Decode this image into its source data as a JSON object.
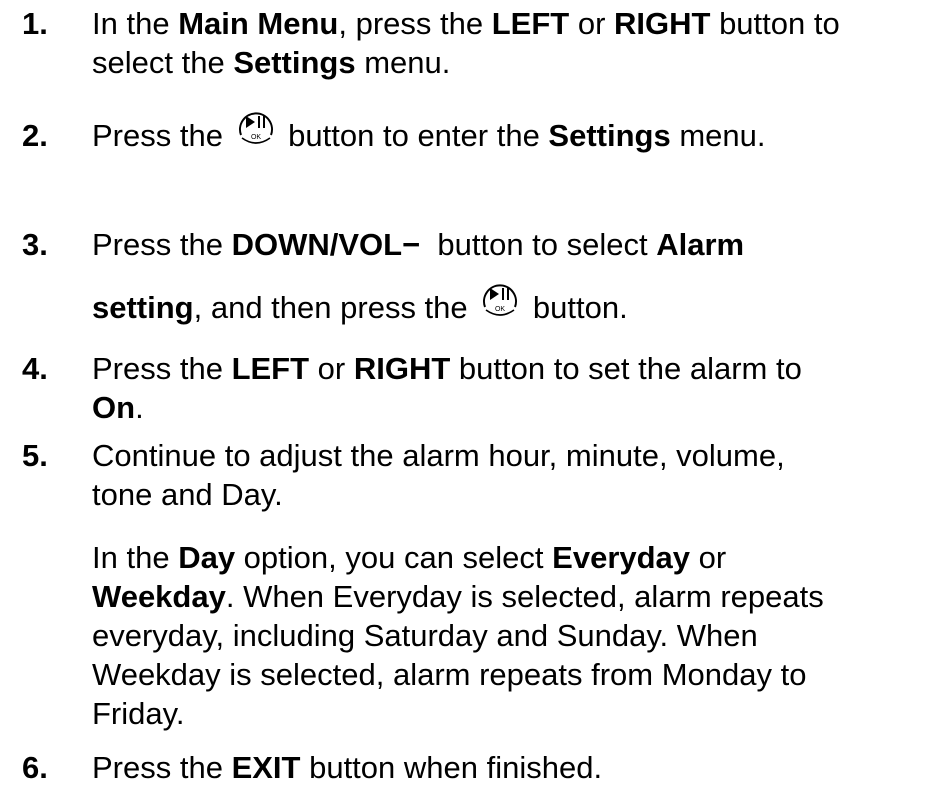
{
  "steps": [
    {
      "num": "1.",
      "l1": [
        "In the ",
        "Main Menu",
        ", press the ",
        "LEFT",
        " or ",
        "RIGHT",
        " button to"
      ],
      "l2": [
        "select the ",
        "Settings",
        " menu."
      ]
    },
    {
      "num": "2.",
      "l1a": "Press the ",
      "l1b": " button to enter the ",
      "l1c": "Settings",
      "l1d": " menu."
    },
    {
      "num": "3.",
      "l1a": "Press the ",
      "l1b": "DOWN/VOL−",
      "l1c": "  button to select ",
      "l1d": "Alarm",
      "l2a": "setting",
      "l2b": ", and then press the ",
      "l2c": " button."
    },
    {
      "num": "4.",
      "l1": [
        "Press the ",
        "LEFT",
        " or ",
        "RIGHT",
        " button to set the alarm to"
      ],
      "l2": [
        "On",
        "."
      ]
    },
    {
      "num": "5.",
      "l1": "Continue to adjust the alarm hour, minute, volume,",
      "l2": "tone and Day.",
      "p1": [
        "In the ",
        "Day",
        " option, you can select ",
        "Everyday",
        " or"
      ],
      "p2": [
        "Weekday",
        ". When Everyday is selected, alarm repeats"
      ],
      "p3": "everyday, including Saturday and Sunday. When",
      "p4": "Weekday is selected, alarm repeats from Monday to",
      "p5": "Friday."
    },
    {
      "num": "6.",
      "l1": [
        "Press the ",
        "EXIT",
        " button when finished."
      ]
    }
  ],
  "icons": {
    "ok_button": "play-pause-ok-icon",
    "ok_label": "OK"
  }
}
